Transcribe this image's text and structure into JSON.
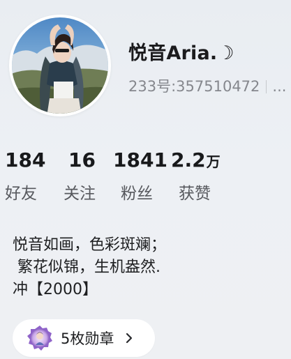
{
  "profile": {
    "username": "悦音Aria.☽",
    "uid": "233号:357510472",
    "uid_overflow": "..."
  },
  "stats": [
    {
      "value": "184",
      "unit": "",
      "label": "好友"
    },
    {
      "value": "16",
      "unit": "",
      "label": "关注"
    },
    {
      "value": "1841",
      "unit": "",
      "label": "粉丝"
    },
    {
      "value": "2.2",
      "unit": "万",
      "label": "获赞"
    }
  ],
  "bio": {
    "lines": [
      "悦音如画，色彩斑斓；",
      " 繁花似锦，生机盎然.",
      "冲【2000】"
    ]
  },
  "medals": {
    "label": "5枚勋章",
    "icon": "medal-badge-icon",
    "chevron": "chevron-right-icon"
  },
  "colors": {
    "background": "#edf0f4",
    "text_primary": "#1b1b1d",
    "text_secondary": "#85878d",
    "card": "#ffffff"
  }
}
